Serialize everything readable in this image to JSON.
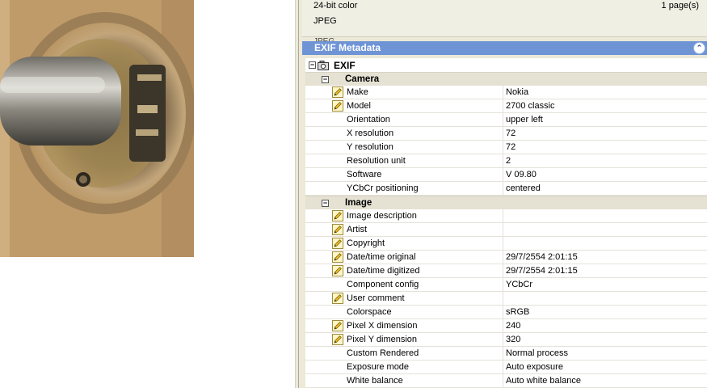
{
  "image_info": {
    "format": "24-bit color",
    "pages": "1 page(s)",
    "type": "JPEG",
    "ghost_type": "JPEG"
  },
  "panel": {
    "title": "EXIF Metadata",
    "collapse_icon": "double-chevron-up-icon"
  },
  "tree": {
    "root_label": "EXIF",
    "groups": [
      {
        "label": "Camera",
        "rows": [
          {
            "name": "Make",
            "value": "Nokia",
            "editable": true
          },
          {
            "name": "Model",
            "value": "2700 classic",
            "editable": true
          },
          {
            "name": "Orientation",
            "value": "upper left",
            "editable": false
          },
          {
            "name": "X resolution",
            "value": "72",
            "editable": false
          },
          {
            "name": "Y resolution",
            "value": "72",
            "editable": false
          },
          {
            "name": "Resolution unit",
            "value": "2",
            "editable": false
          },
          {
            "name": "Software",
            "value": "V 09.80",
            "editable": false
          },
          {
            "name": "YCbCr positioning",
            "value": "centered",
            "editable": false
          }
        ]
      },
      {
        "label": "Image",
        "rows": [
          {
            "name": "Image description",
            "value": "",
            "editable": true
          },
          {
            "name": "Artist",
            "value": "",
            "editable": true
          },
          {
            "name": "Copyright",
            "value": "",
            "editable": true
          },
          {
            "name": "Date/time original",
            "value": "29/7/2554 2:01:15",
            "editable": true
          },
          {
            "name": "Date/time digitized",
            "value": "29/7/2554 2:01:15",
            "editable": true
          },
          {
            "name": "Component config",
            "value": "YCbCr",
            "editable": false
          },
          {
            "name": "User comment",
            "value": "",
            "editable": true
          },
          {
            "name": "Colorspace",
            "value": "sRGB",
            "editable": false
          },
          {
            "name": "Pixel X dimension",
            "value": "240",
            "editable": true
          },
          {
            "name": "Pixel Y dimension",
            "value": "320",
            "editable": true
          },
          {
            "name": "Custom Rendered",
            "value": "Normal process",
            "editable": false
          },
          {
            "name": "Exposure mode",
            "value": "Auto exposure",
            "editable": false
          },
          {
            "name": "White balance",
            "value": "Auto white balance",
            "editable": false
          }
        ]
      }
    ]
  }
}
